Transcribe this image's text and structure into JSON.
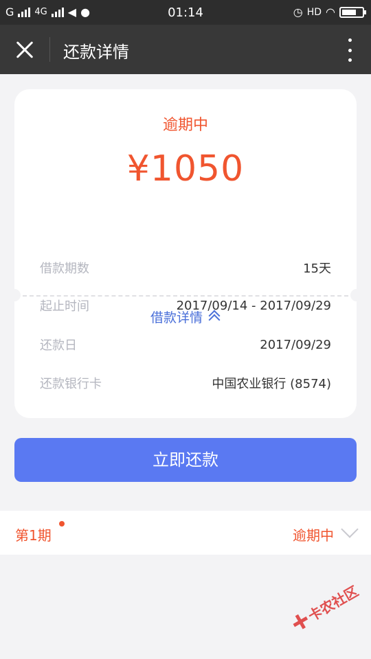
{
  "status_bar": {
    "carrier1": "G",
    "carrier2": "4G",
    "time": "01:14",
    "hd": "HD"
  },
  "nav": {
    "title": "还款详情"
  },
  "loan": {
    "status": "逾期中",
    "amount": "¥1050",
    "detail_toggle": "借款详情",
    "rows": [
      {
        "label": "借款期数",
        "value": "15天"
      },
      {
        "label": "起止时间",
        "value": "2017/09/14 - 2017/09/29"
      },
      {
        "label": "还款日",
        "value": "2017/09/29"
      },
      {
        "label": "还款银行卡",
        "value": "中国农业银行 (8574)"
      }
    ]
  },
  "pay_button": {
    "label": "立即还款"
  },
  "period": {
    "label": "第1期",
    "status": "逾期中"
  },
  "watermark": {
    "text": "卡农社区"
  },
  "colors": {
    "accent_red": "#f0552f",
    "accent_blue": "#4a6fd9",
    "button_blue": "#5a79f2",
    "nav_bg": "#383838",
    "page_bg": "#f3f3f5"
  }
}
